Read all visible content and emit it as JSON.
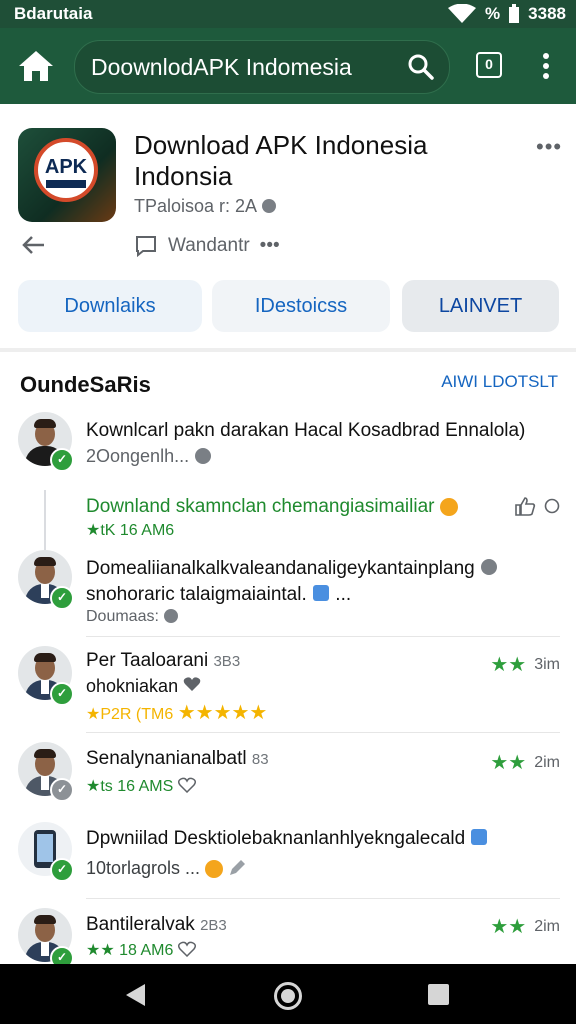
{
  "status_bar": {
    "carrier": "Bdarutaia",
    "battery": "%",
    "time": "3388"
  },
  "toolbar": {
    "url": "DoownlodAPK Indomesia",
    "tab_count": "0"
  },
  "app": {
    "title": "Download APK Indonesia Indonsia",
    "subtitle": "TPaloisoa r: 2A",
    "icon_text": "APK",
    "comment_label": "Wandantr",
    "buttons": [
      "Downlaiks",
      "IDestoicss",
      "LAINVET"
    ]
  },
  "section": {
    "title": "OundeSaRis",
    "link": "AIWI LDOTSLT"
  },
  "items": [
    {
      "line1": "Kownlcarl pakn darakan Hacal Kosadbrad Ennalola)",
      "meta": "2Oongenlh..."
    },
    {
      "line1": "Downland skamnclan chemangiasimailiar",
      "stars": "★tK 16 AM6"
    },
    {
      "line1": "Domealiianalkalkvaleandanaligeykantainplang",
      "line2": "snohoraric talaigmaiaintal.",
      "meta": "Doumaas:"
    },
    {
      "line1": "Per Taaloarani",
      "line1_suffix": "3B3",
      "line2": "ohokniakan",
      "stars": "★P2R (TM6",
      "time": "3im"
    },
    {
      "line1": "Senalynanianalbatl",
      "line1_suffix": "83",
      "stars": "★ts 16 AMS",
      "time": "2im"
    },
    {
      "line1": "Dpwniilad Desktiolebaknanlanhlyekngalecald",
      "meta": "10torlagrols ..."
    },
    {
      "line1": "Bantileralvak",
      "line1_suffix": "2B3",
      "stars": "★★ 18 AM6",
      "time": "2im"
    }
  ],
  "colors": {
    "toolbar": "#1e5a3c",
    "status_bar": "#1f4f37",
    "accent": "#1565c0",
    "green": "#2e9e3c",
    "star": "#f4b400"
  }
}
